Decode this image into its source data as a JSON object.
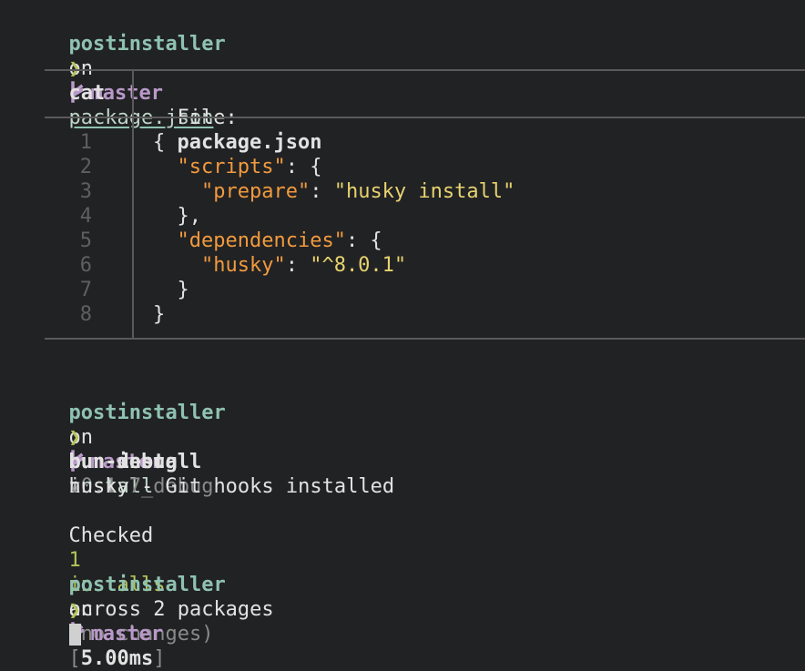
{
  "prompt": {
    "dir": "postinstaller",
    "on": "on",
    "branch": "master",
    "chevron": "❯"
  },
  "cmd1": {
    "program": "cat",
    "arg": "package.json"
  },
  "bat": {
    "file_label": "File:",
    "file_name": "package.json",
    "lines": [
      {
        "num": "1",
        "parts": [
          {
            "t": "{",
            "c": "plain"
          }
        ]
      },
      {
        "num": "2",
        "parts": [
          {
            "t": "  ",
            "c": "plain"
          },
          {
            "t": "\"scripts\"",
            "c": "key"
          },
          {
            "t": ": {",
            "c": "plain"
          }
        ]
      },
      {
        "num": "3",
        "parts": [
          {
            "t": "    ",
            "c": "plain"
          },
          {
            "t": "\"prepare\"",
            "c": "key"
          },
          {
            "t": ": ",
            "c": "plain"
          },
          {
            "t": "\"husky install\"",
            "c": "str"
          }
        ]
      },
      {
        "num": "4",
        "parts": [
          {
            "t": "  },",
            "c": "plain"
          }
        ]
      },
      {
        "num": "5",
        "parts": [
          {
            "t": "  ",
            "c": "plain"
          },
          {
            "t": "\"dependencies\"",
            "c": "key"
          },
          {
            "t": ": {",
            "c": "plain"
          }
        ]
      },
      {
        "num": "6",
        "parts": [
          {
            "t": "    ",
            "c": "plain"
          },
          {
            "t": "\"husky\"",
            "c": "key"
          },
          {
            "t": ": ",
            "c": "plain"
          },
          {
            "t": "\"^8.0.1\"",
            "c": "str"
          }
        ]
      },
      {
        "num": "7",
        "parts": [
          {
            "t": "  }",
            "c": "plain"
          }
        ]
      },
      {
        "num": "8",
        "parts": [
          {
            "t": "}",
            "c": "plain"
          }
        ]
      }
    ]
  },
  "cmd2": {
    "program": "bun-debug",
    "arg": "install"
  },
  "output": {
    "bun_install": "bun install",
    "version": "v0.1.7_debug",
    "husky_line": "husky - Git hooks installed",
    "checked": "Checked",
    "count": "1",
    "installs": "installs",
    "across": "across 2 packages",
    "no_changes": "(no changes)",
    "bracket_open": "[",
    "timing": "5.00ms",
    "bracket_close": "]"
  },
  "colors": {
    "background": "#212224",
    "teal": "#8fc2b0",
    "purple": "#b999c9",
    "green": "#b5c45a",
    "json_key": "#f19a3e",
    "json_string": "#e8d36e"
  }
}
